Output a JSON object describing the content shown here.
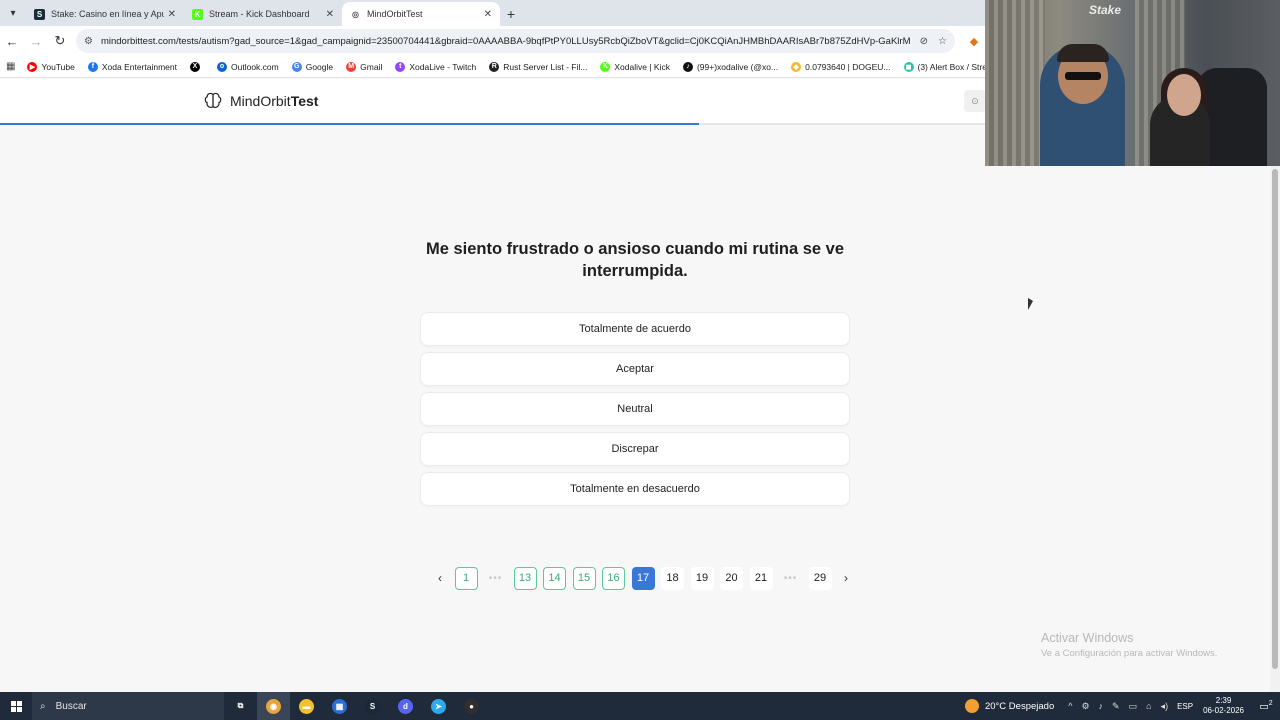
{
  "browser": {
    "tabs": [
      {
        "title": "Stake: Casino en línea y Apuesta",
        "favicon": "stake-favicon",
        "color": "#1a2c38",
        "glyph": "S"
      },
      {
        "title": "Stream - Kick Dashboard",
        "favicon": "kick-favicon",
        "color": "#53fc18",
        "glyph": "K"
      },
      {
        "title": "MindOrbitTest",
        "favicon": "globe-favicon",
        "color": "#ffffff",
        "glyph": "◎"
      }
    ],
    "url": "mindorbittest.com/tests/autism?gad_source=1&gad_campaignid=23500704441&gbraid=0AAAABBA-9bqfPtPY0LLUsy5RcbQiZboVT&gclid=Cj0KCQiAnJHMBhDAARIsABr7b875ZdHVp-GaKlrM...",
    "bookmarks": [
      {
        "label": "YouTube",
        "color": "#ff0000",
        "glyph": "▶"
      },
      {
        "label": "Xoda Entertainment",
        "color": "#1877f2",
        "glyph": "f"
      },
      {
        "label": "",
        "color": "#000000",
        "glyph": "X"
      },
      {
        "label": "Outlook.com",
        "color": "#0a64d6",
        "glyph": "o"
      },
      {
        "label": "Google",
        "color": "#4285f4",
        "glyph": "G"
      },
      {
        "label": "Gmail",
        "color": "#ea4335",
        "glyph": "M"
      },
      {
        "label": "XodaLive - Twitch",
        "color": "#9146ff",
        "glyph": "t"
      },
      {
        "label": "Rust Server List - Fil...",
        "color": "#222222",
        "glyph": "R"
      },
      {
        "label": "Xodalive | Kick",
        "color": "#53fc18",
        "glyph": "K"
      },
      {
        "label": "(99+)xodalive (@xo...",
        "color": "#111111",
        "glyph": "♪"
      },
      {
        "label": "0.0793640 | DOGEU...",
        "color": "#f3ba2f",
        "glyph": "◆"
      },
      {
        "label": "(3) Alert Box / Strea...",
        "color": "#31c3a2",
        "glyph": "◼"
      }
    ]
  },
  "site": {
    "brand_regular": "MindOrbit",
    "brand_bold": "Test",
    "header_button": "⊙"
  },
  "progress": {
    "fraction": 0.55
  },
  "question": {
    "text": "Me siento frustrado o ansioso cuando mi rutina se ve interrumpida."
  },
  "options": [
    "Totalmente de acuerdo",
    "Aceptar",
    "Neutral",
    "Discrepar",
    "Totalmente en desacuerdo"
  ],
  "pagination": {
    "prev": "‹",
    "next": "›",
    "ellipsis": "•••",
    "pages": [
      {
        "label": "1",
        "state": "done"
      },
      {
        "label": "•••",
        "state": "dots"
      },
      {
        "label": "13",
        "state": "done"
      },
      {
        "label": "14",
        "state": "done"
      },
      {
        "label": "15",
        "state": "done"
      },
      {
        "label": "16",
        "state": "done"
      },
      {
        "label": "17",
        "state": "current"
      },
      {
        "label": "18",
        "state": "pending"
      },
      {
        "label": "19",
        "state": "pending"
      },
      {
        "label": "20",
        "state": "pending"
      },
      {
        "label": "21",
        "state": "pending"
      },
      {
        "label": "•••",
        "state": "dots"
      },
      {
        "label": "29",
        "state": "pending"
      }
    ]
  },
  "watermark": {
    "line1": "Activar Windows",
    "line2": "Ve a Configuración para activar Windows."
  },
  "webcam": {
    "overlay_text": "Stake"
  },
  "taskbar": {
    "search_label": "Buscar",
    "apps": [
      {
        "name": "task-view-icon",
        "color": "transparent",
        "glyph": "⧉",
        "active": false
      },
      {
        "name": "chrome-icon",
        "color": "#e8a53a",
        "glyph": "◉",
        "active": true
      },
      {
        "name": "file-explorer-icon",
        "color": "#f2c12e",
        "glyph": "▬",
        "active": false
      },
      {
        "name": "store-icon",
        "color": "#2a6fd6",
        "glyph": "▦",
        "active": false
      },
      {
        "name": "steam-icon",
        "color": "#1b2838",
        "glyph": "S",
        "active": false
      },
      {
        "name": "discord-icon",
        "color": "#5865f2",
        "glyph": "d",
        "active": false
      },
      {
        "name": "telegram-icon",
        "color": "#2aabee",
        "glyph": "➤",
        "active": false
      },
      {
        "name": "obs-icon",
        "color": "#302e31",
        "glyph": "●",
        "active": false
      }
    ],
    "weather": "20°C  Despejado",
    "language": "ESP",
    "time": "2:39",
    "date": "06-02-2026",
    "notifications": "2"
  },
  "colors": {
    "accent": "#3a78d8",
    "done_border": "#5cc99a",
    "done_text": "#3aaa7a"
  }
}
